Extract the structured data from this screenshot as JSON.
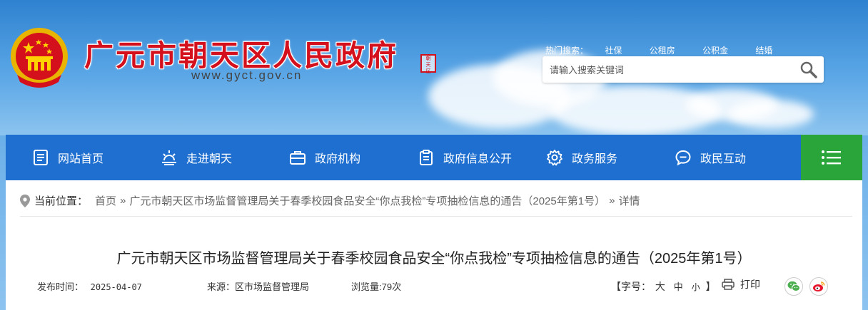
{
  "header": {
    "site_title": "广元市朝天区人民政府",
    "site_url": "www.gyct.gov.cn",
    "seal_text": "朝天区",
    "hot_label": "热门搜索：",
    "hot_items": [
      "社保",
      "公租房",
      "公积金",
      "结婚"
    ],
    "search_placeholder": "请输入搜索关键词"
  },
  "nav": {
    "items": [
      {
        "label": "网站首页",
        "icon": "document-icon"
      },
      {
        "label": "走进朝天",
        "icon": "sunrise-icon"
      },
      {
        "label": "政府机构",
        "icon": "briefcase-icon"
      },
      {
        "label": "政府信息公开",
        "icon": "clipboard-icon"
      },
      {
        "label": "政务服务",
        "icon": "gear-icon"
      },
      {
        "label": "政民互动",
        "icon": "chat-icon"
      }
    ],
    "menu_icon": "hamburger-icon"
  },
  "breadcrumb": {
    "label": "当前位置：",
    "items": [
      "首页",
      "广元市朝天区市场监督管理局关于春季校园食品安全“你点我检”专项抽检信息的通告（2025年第1号）",
      "详情"
    ],
    "separator": "»"
  },
  "article": {
    "title": "广元市朝天区市场监督管理局关于春季校园食品安全“你点我检”专项抽检信息的通告（2025年第1号）",
    "publish_label": "发布时间：",
    "publish_date": "2025-04-07",
    "source_label": "来源：",
    "source": "区市场监督管理局",
    "views_label": "浏览量:",
    "views": "79次",
    "font_size_open": "【字号：",
    "font_large": "大",
    "font_medium": "中",
    "font_small": "小",
    "font_size_close": "】",
    "print_label": "打印"
  },
  "colors": {
    "nav_bg": "#1e6fd0",
    "menu_bg": "#2aa53a",
    "title_red": "#d4101c",
    "wechat": "#4caf50",
    "weibo": "#e6162d"
  }
}
